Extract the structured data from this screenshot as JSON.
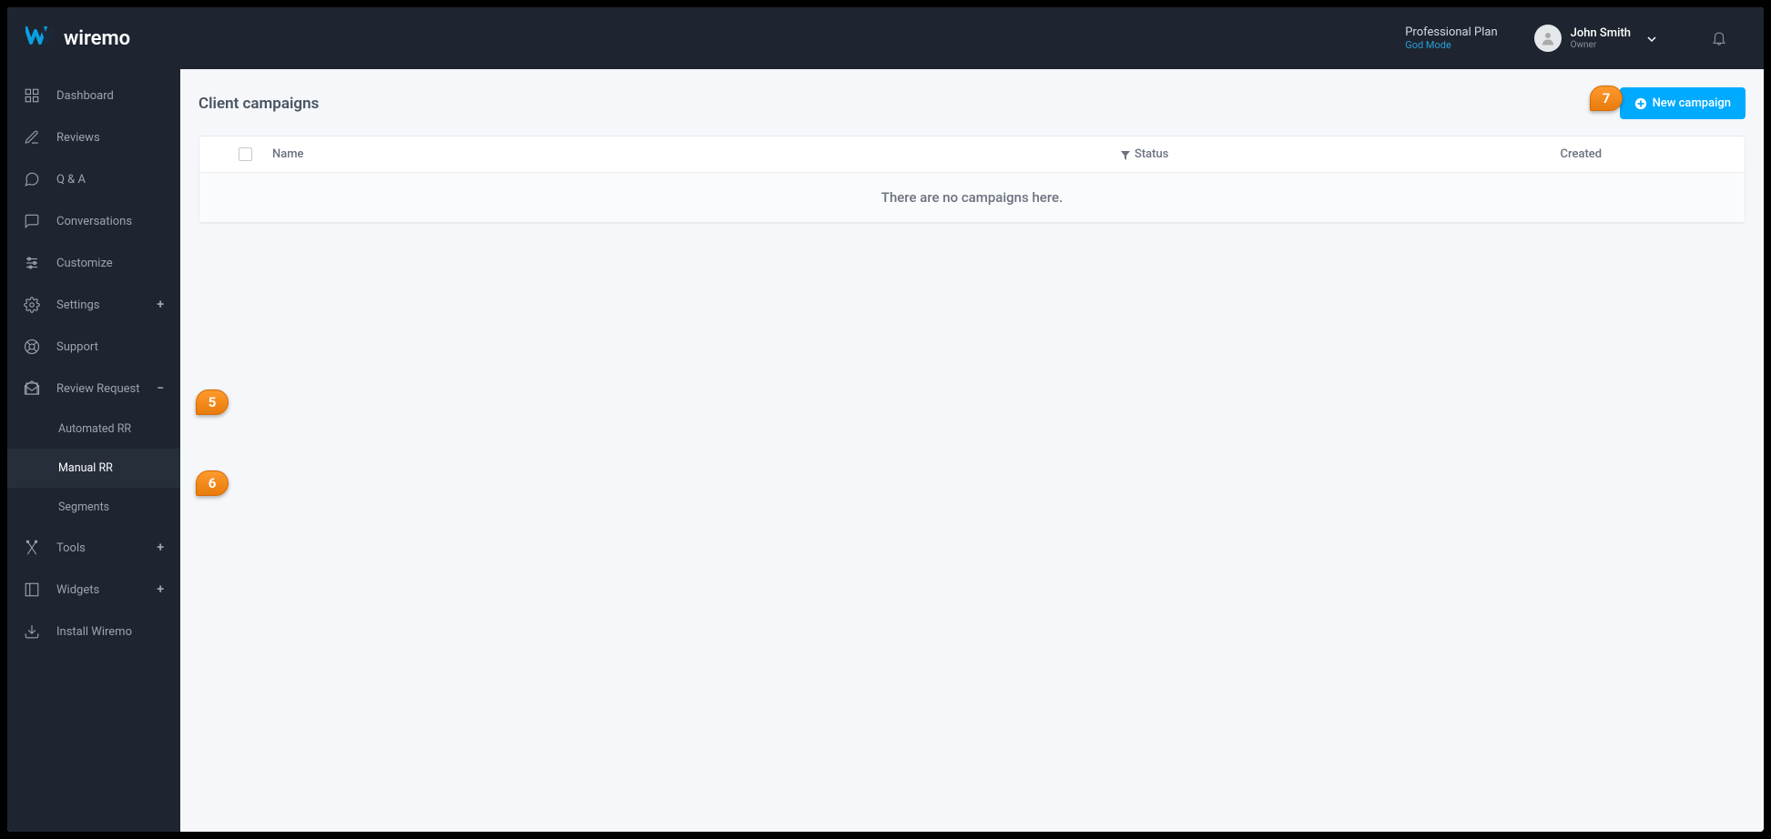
{
  "brand": "wiremo",
  "topbar": {
    "plan": "Professional Plan",
    "god_mode": "God Mode",
    "user_name": "John Smith",
    "user_role": "Owner"
  },
  "sidebar": {
    "dashboard": "Dashboard",
    "reviews": "Reviews",
    "qa": "Q & A",
    "conversations": "Conversations",
    "customize": "Customize",
    "settings": "Settings",
    "support": "Support",
    "review_request": "Review Request",
    "automated_rr": "Automated RR",
    "manual_rr": "Manual RR",
    "segments": "Segments",
    "tools": "Tools",
    "widgets": "Widgets",
    "install": "Install Wiremo"
  },
  "content": {
    "title": "Client campaigns",
    "new_campaign_btn": "New campaign",
    "columns": {
      "name": "Name",
      "status": "Status",
      "created": "Created"
    },
    "empty_state": "There are no campaigns here."
  },
  "callouts": {
    "c5": "5",
    "c6": "6",
    "c7": "7"
  }
}
